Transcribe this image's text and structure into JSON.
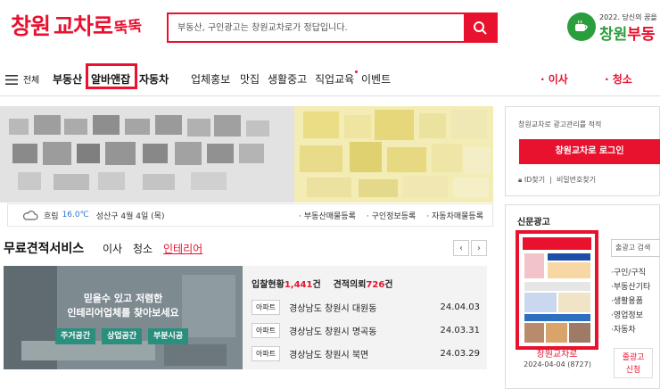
{
  "header": {
    "logo_main": "창원",
    "logo_sub": "교차로",
    "logo_mark": "뚝뚝",
    "search_placeholder": "부동산, 구인광고는 창원교차로가 정답입니다.",
    "brand_tagline": "2022. 당신의 꿈을",
    "brand_name_a": "창원",
    "brand_name_b": "부동"
  },
  "nav": {
    "menu_label": "전체",
    "items": [
      {
        "label": "부동산"
      },
      {
        "label": "알바앤잡"
      },
      {
        "label": "자동차"
      },
      {
        "label": "업체홍보"
      },
      {
        "label": "맛집"
      },
      {
        "label": "생활중고"
      },
      {
        "label": "직업교육"
      },
      {
        "label": "이벤트"
      }
    ],
    "right_items": [
      {
        "label": "이사"
      },
      {
        "label": "청소"
      }
    ]
  },
  "weather": {
    "condition": "흐림",
    "temp": "16.0℃",
    "date_text": "성산구 4월 4일 (목)",
    "links": [
      "부동산매물등록",
      "구인정보등록",
      "자동차매물등록"
    ]
  },
  "service": {
    "title": "무료견적서비스",
    "tabs": [
      "이사",
      "청소",
      "인테리어"
    ],
    "active_tab": "인테리어",
    "promo_line1": "믿을수 있고 저렴한",
    "promo_line2": "인테리어업체를 찾아보세요",
    "promo_buttons": [
      "주거공간",
      "상업공간",
      "부분시공"
    ],
    "stats_label_a": "입찰현황",
    "stats_value_a": "1,441",
    "stats_unit_a": "건",
    "stats_label_b": "견적의뢰",
    "stats_value_b": "726",
    "stats_unit_b": "건",
    "rows": [
      {
        "type": "아파트",
        "address": "경상남도 창원시 대원동",
        "date": "24.04.03"
      },
      {
        "type": "아파트",
        "address": "경상남도 창원시 명곡동",
        "date": "24.03.31"
      },
      {
        "type": "아파트",
        "address": "경상남도 창원시 북면",
        "date": "24.03.29"
      }
    ]
  },
  "sidebar": {
    "login_note": "창원교차로 광고관리를 적적",
    "login_button": "창원교차로 로그인",
    "id_find": "ID찾기",
    "pw_find": "비밀번호찾기",
    "news_title": "신문광고",
    "thumb_caption": "창원교차로",
    "thumb_date": "2024-04-04 (8727)",
    "side_search": "출광고 검색",
    "side_links": [
      "구인/구직",
      "부동산기타",
      "생활용품",
      "영업정보",
      "자동차"
    ],
    "apply_line1": "줄광고",
    "apply_line2": "신청"
  },
  "colors": {
    "accent": "#e8122f",
    "brand_green": "#2a9d3c",
    "promo_teal": "#2a8f7e"
  }
}
